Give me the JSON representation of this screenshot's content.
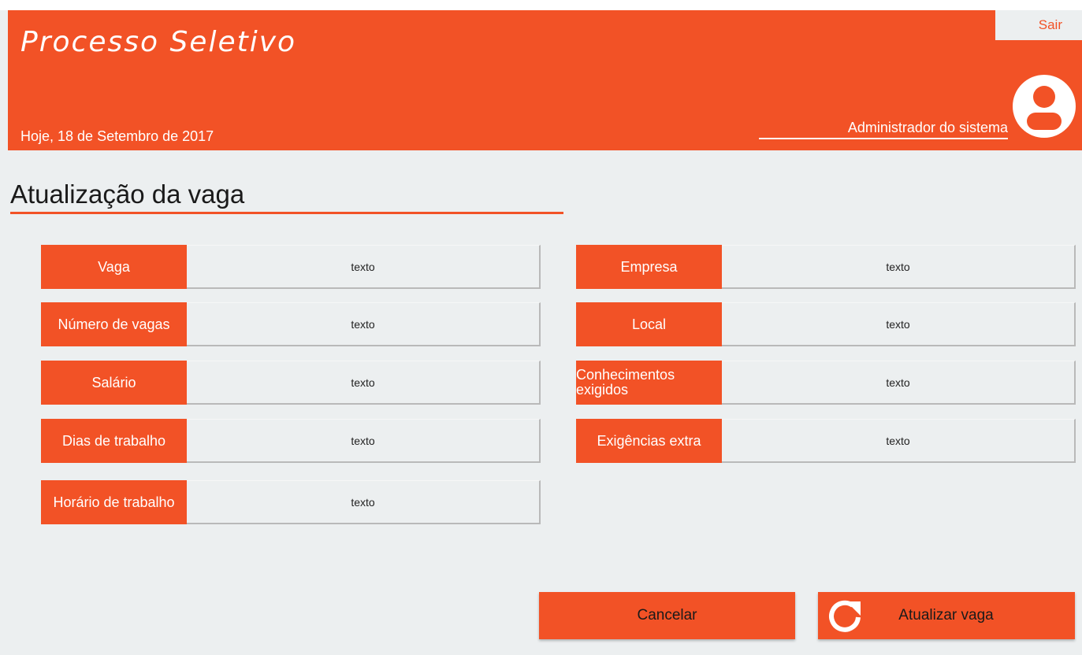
{
  "header": {
    "title": "Processo Seletivo",
    "date": "Hoje, 18 de Setembro de 2017",
    "logout_label": "Sair",
    "user_name": "Administrador do sistema"
  },
  "page": {
    "title": "Atualização da vaga"
  },
  "form": {
    "left": [
      {
        "label": "Vaga",
        "value": "texto"
      },
      {
        "label": "Número de vagas",
        "value": "texto"
      },
      {
        "label": "Salário",
        "value": "texto"
      },
      {
        "label": "Dias de trabalho",
        "value": "texto"
      },
      {
        "label": "Horário de trabalho",
        "value": "texto"
      }
    ],
    "right": [
      {
        "label": "Empresa",
        "value": "texto"
      },
      {
        "label": "Local",
        "value": "texto"
      },
      {
        "label": "Conhecimentos exigidos",
        "value": "texto"
      },
      {
        "label": "Exigências extra",
        "value": "texto"
      }
    ]
  },
  "actions": {
    "cancel_label": "Cancelar",
    "update_label": "Atualizar vaga"
  },
  "icons": {
    "user": "user-avatar-icon",
    "update": "refresh-icon"
  },
  "colors": {
    "accent": "#f25226",
    "background": "#eceff0",
    "text": "#1a1a1a"
  }
}
